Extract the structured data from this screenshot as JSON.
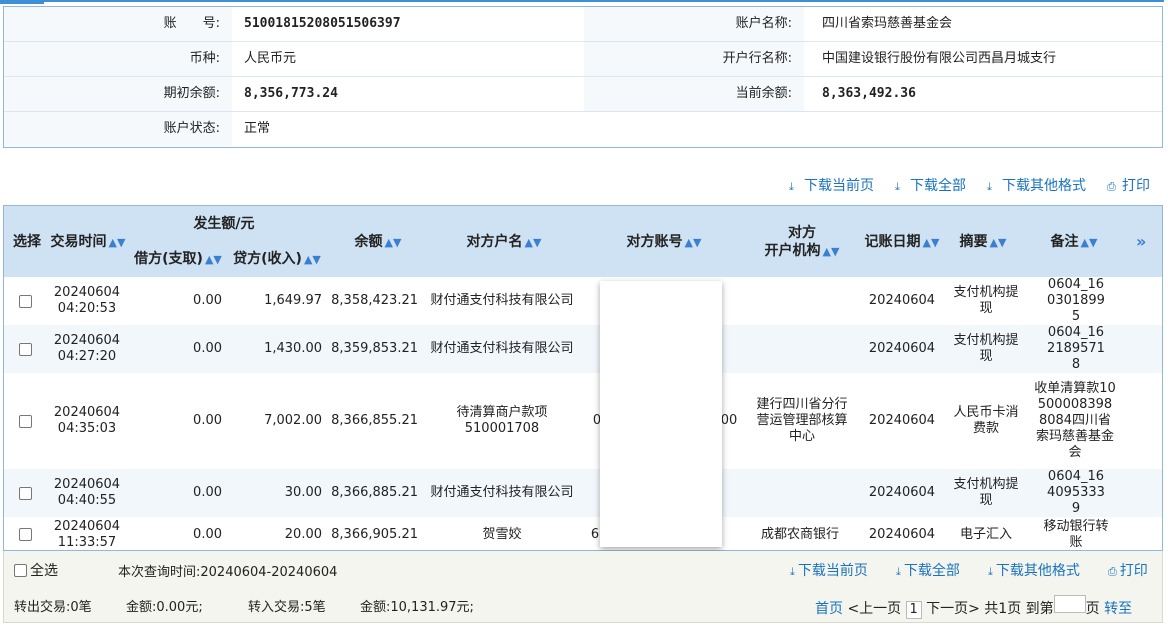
{
  "account": {
    "no_label": "账　　号:",
    "no": "51001815208051506397",
    "name_label": "账户名称:",
    "name": "四川省索玛慈善基金会",
    "currency_label": "币种:",
    "currency": "人民币元",
    "bank_label": "开户行名称:",
    "bank": "中国建设银行股份有限公司西昌月城支行",
    "opening_label": "期初余额:",
    "opening": "8,356,773.24",
    "current_label": "当前余额:",
    "current": "8,363,492.36",
    "status_label": "账户状态:",
    "status": "正常"
  },
  "actions": {
    "download_page": "下载当前页",
    "download_all": "下载全部",
    "download_other": "下载其他格式",
    "print": "打印"
  },
  "table": {
    "headers": {
      "select": "选择",
      "time": "交易时间",
      "amount_group": "发生额/元",
      "debit": "借方(支取)",
      "credit": "贷方(收入)",
      "balance": "余额",
      "cp_name": "对方户名",
      "cp_account": "对方账号",
      "cp_bank_1": "对方",
      "cp_bank_2": "开户机构",
      "post_date": "记账日期",
      "summary": "摘要",
      "remark": "备注",
      "more": "»"
    },
    "rows": [
      {
        "date": "20240604",
        "time": "04:20:53",
        "debit": "0.00",
        "credit": "1,649.97",
        "balance": "8,358,423.21",
        "cp_name": "财付通支付科技有限公司",
        "cp_account": "",
        "cp_bank": "",
        "post_date": "20240604",
        "summary": "支付机构提现",
        "remark": "0604_1603018995"
      },
      {
        "date": "20240604",
        "time": "04:27:20",
        "debit": "0.00",
        "credit": "1,430.00",
        "balance": "8,359,853.21",
        "cp_name": "财付通支付科技有限公司",
        "cp_account": "",
        "cp_bank": "",
        "post_date": "20240604",
        "summary": "支付机构提现",
        "remark": "0604_1621895718"
      },
      {
        "date": "20240604",
        "time": "04:35:03",
        "debit": "0.00",
        "credit": "7,002.00",
        "balance": "8,366,855.21",
        "cp_name": "待清算商户款项510001708",
        "cp_account": "0",
        "cp_account_tail": "00",
        "cp_bank": "建行四川省分行营运管理部核算中心",
        "post_date": "20240604",
        "summary": "人民币卡消费款",
        "remark": "收单清算款105000083988084四川省索玛慈善基金会"
      },
      {
        "date": "20240604",
        "time": "04:40:55",
        "debit": "0.00",
        "credit": "30.00",
        "balance": "8,366,885.21",
        "cp_name": "财付通支付科技有限公司",
        "cp_account": "",
        "cp_bank": "",
        "post_date": "20240604",
        "summary": "支付机构提现",
        "remark": "0604_1640953339"
      },
      {
        "date": "20240604",
        "time": "11:33:57",
        "debit": "0.00",
        "credit": "20.00",
        "balance": "8,366,905.21",
        "cp_name": "贺雪姣",
        "cp_account": "6",
        "cp_bank": "成都农商银行",
        "post_date": "20240604",
        "summary": "电子汇入",
        "remark": "移动银行转账"
      }
    ]
  },
  "footer": {
    "select_all": "全选",
    "query_time": "本次查询时间:20240604-20240604",
    "out_tx": "转出交易:0笔",
    "out_amount": "金额:0.00元;",
    "in_tx": "转入交易:5笔",
    "in_amount": "金额:10,131.97元;",
    "first": "首页",
    "prev": "<上一页",
    "page": "1",
    "next": "下一页>",
    "total": "共1页",
    "goto": "到第",
    "page_unit": "页",
    "go": "转至"
  }
}
